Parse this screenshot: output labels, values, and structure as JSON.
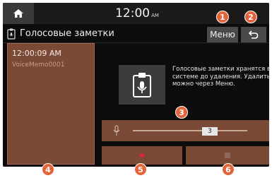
{
  "statusbar": {
    "time": "12:00",
    "ampm": "AM"
  },
  "header": {
    "title": "Голосовые заметки",
    "menu_label": "Меню"
  },
  "memo_list": [
    {
      "time": "12:00:09 AM",
      "name": "VoiceMemo0001"
    }
  ],
  "info": {
    "text": "Голосовые заметки хранятся в системе до удаления. Удалить можно через Меню."
  },
  "player": {
    "counter": "3"
  },
  "callouts": [
    "1",
    "2",
    "3",
    "4",
    "5",
    "6"
  ],
  "colors": {
    "accent": "#e3643a",
    "panel": "#7b4a36",
    "record": "#e2233b"
  }
}
